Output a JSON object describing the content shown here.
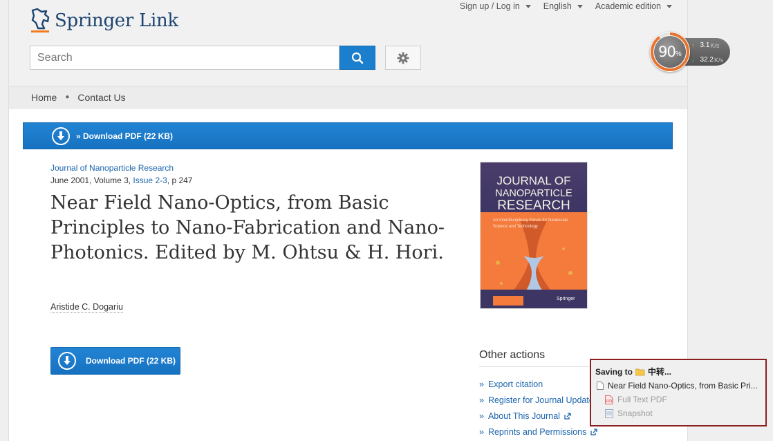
{
  "header": {
    "logo_brand": "Springer",
    "logo_suffix": "Link",
    "utility": {
      "signup_label": "Sign up / Log in",
      "language_label": "English",
      "edition_label": "Academic edition"
    },
    "search": {
      "placeholder": "Search",
      "value": ""
    }
  },
  "nav": {
    "items": [
      {
        "label": "Home"
      },
      {
        "label": "Contact Us"
      }
    ]
  },
  "banner": {
    "download_label": "» Download PDF (22 KB)"
  },
  "article": {
    "journal": "Journal of Nanoparticle Research",
    "meta_prefix": "June 2001, Volume 3, ",
    "issue": "Issue 2-3",
    "meta_suffix": ", p 247",
    "title": "Near Field Nano-Optics, from Basic Principles to Nano-Fabrication and Nano-Photonics. Edited by M. Ohtsu & H. Hori.",
    "author": "Aristide C. Dogariu",
    "download_button": "Download PDF (22 KB)"
  },
  "cover": {
    "line1": "JOURNAL OF",
    "line2": "NANOPARTICLE",
    "line3": "RESEARCH",
    "subtitle": "An Interdisciplinary Forum for Nanoscale Science and Technology",
    "publisher": "Springer"
  },
  "other_actions": {
    "title": "Other actions",
    "items": [
      {
        "label": "Export citation"
      },
      {
        "label": "Register for Journal Updates"
      },
      {
        "label": "About This Journal"
      },
      {
        "label": "Reprints and Permissions"
      }
    ]
  },
  "speed_widget": {
    "percent": "90",
    "percent_unit": "%",
    "percent_value": 0.9,
    "up": "3.1",
    "down": "32.2",
    "unit": "K/s"
  },
  "save_popup": {
    "saving_to": "Saving to",
    "folder": "中转...",
    "item_title": "Near Field Nano-Optics, from Basic Pri...",
    "sub1": "Full Text PDF",
    "sub2": "Snapshot"
  },
  "colors": {
    "accent": "#1b7fce",
    "link": "#1b65ad",
    "brand": "#1d4470",
    "popup_border": "#8b1f1f"
  }
}
